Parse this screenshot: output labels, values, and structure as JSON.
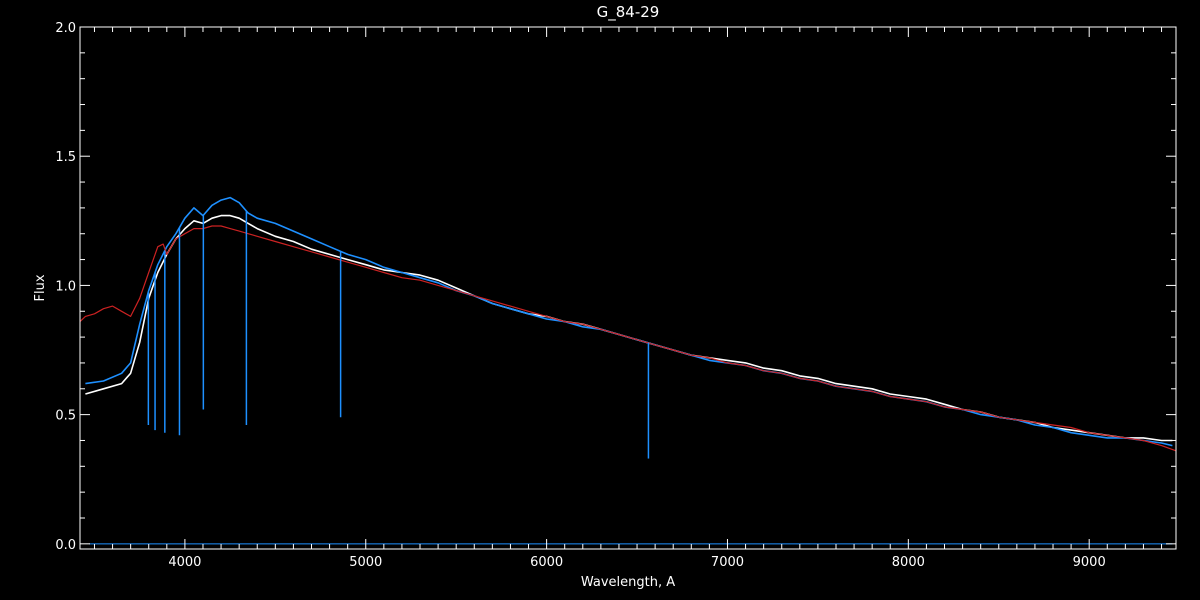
{
  "chart_data": {
    "type": "line",
    "title": "G_84-29",
    "xlabel": "Wavelength, A",
    "ylabel": "Flux",
    "xlim": [
      3420,
      9480
    ],
    "ylim": [
      -0.02,
      2.0
    ],
    "x_ticks": [
      4000,
      5000,
      6000,
      7000,
      8000,
      9000
    ],
    "x_tick_labels": [
      "4000",
      "5000",
      "6000",
      "7000",
      "8000",
      "9000"
    ],
    "y_ticks": [
      0.0,
      0.5,
      1.0,
      1.5,
      2.0
    ],
    "y_tick_labels": [
      "0.0",
      "0.5",
      "1.0",
      "1.5",
      "2.0"
    ],
    "grid": false,
    "colors": {
      "background": "#000000",
      "axes": "#ffffff",
      "observed_white": "#ffffff",
      "observed_blue": "#1e90ff",
      "model_red": "#cc2222"
    },
    "series": [
      {
        "color": "#ffffff",
        "x": [
          3450,
          3550,
          3650,
          3700,
          3750,
          3800,
          3850,
          3900,
          3950,
          4000,
          4050,
          4100,
          4150,
          4200,
          4250,
          4300,
          4350,
          4400,
          4500,
          4600,
          4700,
          4800,
          4900,
          5000,
          5100,
          5200,
          5300,
          5400,
          5500,
          5600,
          5700,
          5800,
          5900,
          6000,
          6100,
          6200,
          6300,
          6400,
          6500,
          6600,
          6700,
          6800,
          6900,
          7000,
          7100,
          7200,
          7300,
          7400,
          7500,
          7600,
          7700,
          7800,
          7900,
          8000,
          8100,
          8200,
          8300,
          8400,
          8500,
          8600,
          8700,
          8800,
          8900,
          9000,
          9100,
          9200,
          9300,
          9400,
          9460
        ],
        "values": [
          0.58,
          0.6,
          0.62,
          0.66,
          0.78,
          0.95,
          1.05,
          1.12,
          1.18,
          1.22,
          1.25,
          1.24,
          1.26,
          1.27,
          1.27,
          1.26,
          1.24,
          1.22,
          1.19,
          1.17,
          1.14,
          1.12,
          1.1,
          1.08,
          1.06,
          1.05,
          1.04,
          1.02,
          0.99,
          0.96,
          0.93,
          0.91,
          0.89,
          0.88,
          0.86,
          0.85,
          0.83,
          0.81,
          0.79,
          0.77,
          0.75,
          0.73,
          0.72,
          0.71,
          0.7,
          0.68,
          0.67,
          0.65,
          0.64,
          0.62,
          0.61,
          0.6,
          0.58,
          0.57,
          0.56,
          0.54,
          0.52,
          0.51,
          0.49,
          0.48,
          0.47,
          0.45,
          0.44,
          0.43,
          0.42,
          0.41,
          0.41,
          0.4,
          0.4
        ]
      },
      {
        "color": "#1e90ff",
        "x": [
          3450,
          3550,
          3650,
          3700,
          3750,
          3800,
          3850,
          3900,
          3950,
          4000,
          4050,
          4100,
          4150,
          4200,
          4250,
          4300,
          4350,
          4400,
          4500,
          4600,
          4700,
          4800,
          4900,
          5000,
          5100,
          5200,
          5300,
          5400,
          5500,
          5600,
          5700,
          5800,
          5900,
          6000,
          6100,
          6200,
          6300,
          6400,
          6500,
          6600,
          6700,
          6800,
          6900,
          7000,
          7100,
          7200,
          7300,
          7400,
          7500,
          7600,
          7700,
          7800,
          7900,
          8000,
          8100,
          8200,
          8300,
          8400,
          8500,
          8600,
          8700,
          8800,
          8900,
          9000,
          9100,
          9200,
          9300,
          9400,
          9460
        ],
        "values": [
          0.62,
          0.63,
          0.66,
          0.7,
          0.85,
          0.98,
          1.08,
          1.15,
          1.2,
          1.26,
          1.3,
          1.27,
          1.31,
          1.33,
          1.34,
          1.32,
          1.28,
          1.26,
          1.24,
          1.21,
          1.18,
          1.15,
          1.12,
          1.1,
          1.07,
          1.05,
          1.03,
          1.01,
          0.98,
          0.96,
          0.93,
          0.91,
          0.89,
          0.87,
          0.86,
          0.84,
          0.83,
          0.81,
          0.79,
          0.77,
          0.75,
          0.73,
          0.71,
          0.7,
          0.69,
          0.67,
          0.66,
          0.64,
          0.63,
          0.61,
          0.6,
          0.59,
          0.57,
          0.56,
          0.55,
          0.53,
          0.52,
          0.5,
          0.49,
          0.48,
          0.46,
          0.45,
          0.43,
          0.42,
          0.41,
          0.41,
          0.4,
          0.39,
          0.38
        ]
      },
      {
        "color": "#cc2222",
        "x": [
          3420,
          3450,
          3500,
          3550,
          3600,
          3650,
          3700,
          3750,
          3800,
          3850,
          3880,
          3900,
          3950,
          4000,
          4050,
          4100,
          4150,
          4200,
          4250,
          4300,
          4350,
          4400,
          4500,
          4600,
          4700,
          4800,
          4900,
          5000,
          5100,
          5200,
          5300,
          5400,
          5500,
          5600,
          5700,
          5800,
          5900,
          6000,
          6100,
          6200,
          6300,
          6400,
          6500,
          6600,
          6700,
          6800,
          6900,
          7000,
          7100,
          7200,
          7300,
          7400,
          7500,
          7600,
          7700,
          7800,
          7900,
          8000,
          8100,
          8200,
          8300,
          8400,
          8500,
          8600,
          8700,
          8800,
          8900,
          9000,
          9100,
          9200,
          9300,
          9400,
          9480
        ],
        "values": [
          0.86,
          0.88,
          0.89,
          0.91,
          0.92,
          0.9,
          0.88,
          0.95,
          1.05,
          1.15,
          1.16,
          1.12,
          1.18,
          1.2,
          1.22,
          1.22,
          1.23,
          1.23,
          1.22,
          1.21,
          1.2,
          1.19,
          1.17,
          1.15,
          1.13,
          1.11,
          1.09,
          1.07,
          1.05,
          1.03,
          1.02,
          1.0,
          0.98,
          0.96,
          0.94,
          0.92,
          0.9,
          0.88,
          0.86,
          0.85,
          0.83,
          0.81,
          0.79,
          0.77,
          0.75,
          0.73,
          0.72,
          0.7,
          0.69,
          0.67,
          0.66,
          0.64,
          0.63,
          0.61,
          0.6,
          0.59,
          0.57,
          0.56,
          0.55,
          0.53,
          0.52,
          0.51,
          0.49,
          0.48,
          0.47,
          0.46,
          0.45,
          0.43,
          0.42,
          0.41,
          0.4,
          0.38,
          0.36
        ]
      }
    ],
    "absorption_lines": [
      {
        "x": 3798,
        "depth": 0.46
      },
      {
        "x": 3835,
        "depth": 0.44
      },
      {
        "x": 3889,
        "depth": 0.43
      },
      {
        "x": 3970,
        "depth": 0.42
      },
      {
        "x": 4102,
        "depth": 0.52
      },
      {
        "x": 4340,
        "depth": 0.46
      },
      {
        "x": 4861,
        "depth": 0.49
      },
      {
        "x": 6563,
        "depth": 0.33
      }
    ]
  }
}
